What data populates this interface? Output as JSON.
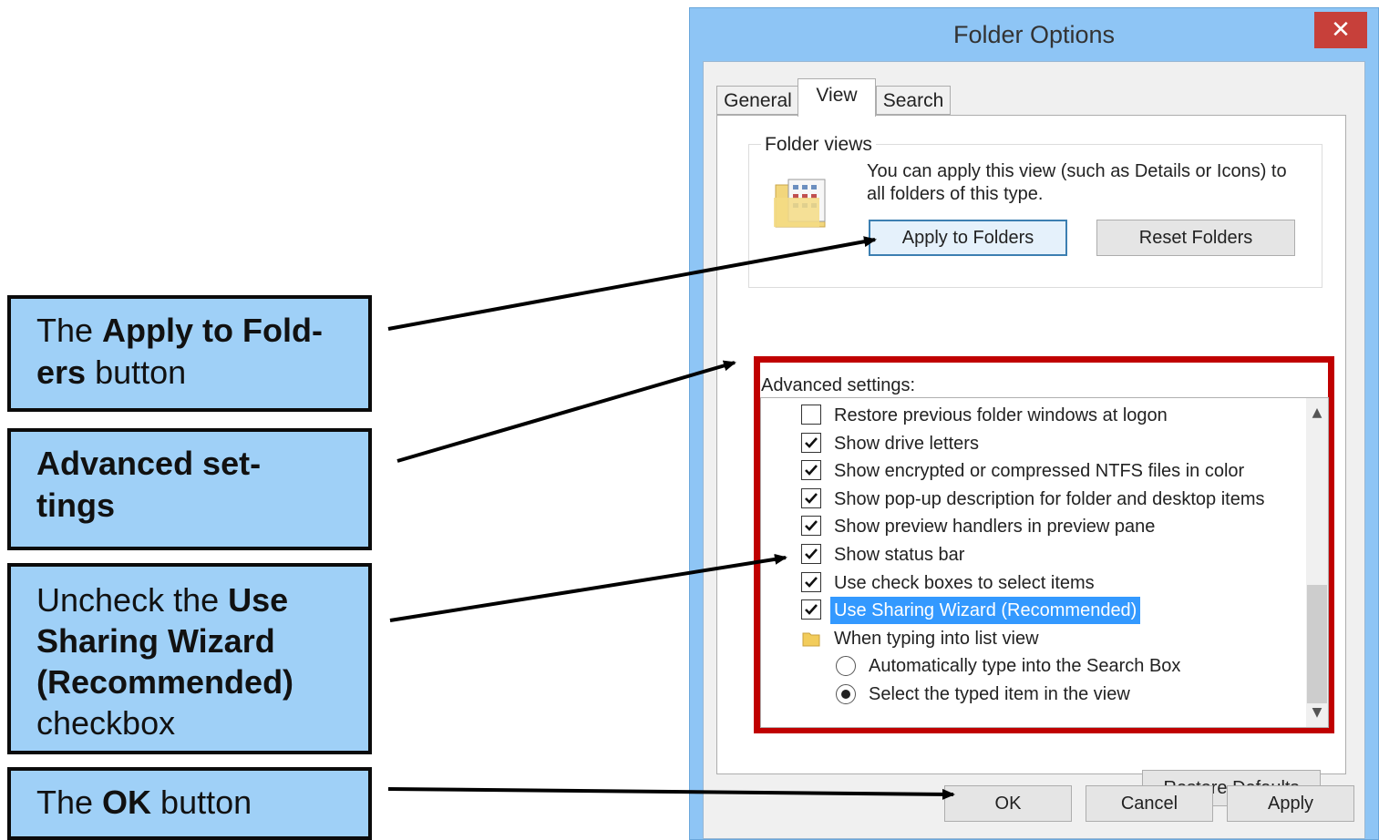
{
  "callouts": [
    {
      "pre": "The ",
      "bold": "Apply to Fold-ers",
      "bold_line1": "Apply to Fold-",
      "bold_line2": "ers",
      "post": " button"
    },
    {
      "bold": "Advanced set-tings",
      "bold_line1": "Advanced set-",
      "bold_line2": "tings"
    },
    {
      "pre": "Uncheck the ",
      "bold_a": "Use",
      "bold_b": "Sharing Wizard",
      "bold_c": "(Recommended)",
      "post": "checkbox"
    },
    {
      "pre": "The ",
      "bold": "OK",
      "post": " button"
    }
  ],
  "dialog": {
    "title": "Folder Options",
    "close_glyph": "✕",
    "tabs": [
      "General",
      "View",
      "Search"
    ],
    "active_tab": "View",
    "folder_views": {
      "label": "Folder views",
      "description": "You can apply this view (such as Details or Icons) to all folders of this type.",
      "apply_button": "Apply to Folders",
      "reset_button": "Reset Folders"
    },
    "advanced": {
      "label": "Advanced settings:",
      "items": [
        {
          "type": "checkbox",
          "checked": false,
          "label": "Restore previous folder windows at logon"
        },
        {
          "type": "checkbox",
          "checked": true,
          "label": "Show drive letters"
        },
        {
          "type": "checkbox",
          "checked": true,
          "label": "Show encrypted or compressed NTFS files in color"
        },
        {
          "type": "checkbox",
          "checked": true,
          "label": "Show pop-up description for folder and desktop items"
        },
        {
          "type": "checkbox",
          "checked": true,
          "label": "Show preview handlers in preview pane"
        },
        {
          "type": "checkbox",
          "checked": true,
          "label": "Show status bar"
        },
        {
          "type": "checkbox",
          "checked": true,
          "label": "Use check boxes to select items"
        },
        {
          "type": "checkbox",
          "checked": true,
          "selected": true,
          "label": "Use Sharing Wizard (Recommended)"
        },
        {
          "type": "folder",
          "label": "When typing into list view"
        },
        {
          "type": "radio",
          "checked": false,
          "label": "Automatically type into the Search Box"
        },
        {
          "type": "radio",
          "checked": true,
          "label": "Select the typed item in the view"
        }
      ],
      "restore_defaults": "Restore Defaults"
    },
    "buttons": {
      "ok": "OK",
      "cancel": "Cancel",
      "apply": "Apply"
    }
  },
  "colors": {
    "callout_bg": "#9fd0f7",
    "highlight_box": "#c00000",
    "selection": "#3399ff",
    "window_frame": "#8ec5f5",
    "close_button": "#c7403a"
  }
}
